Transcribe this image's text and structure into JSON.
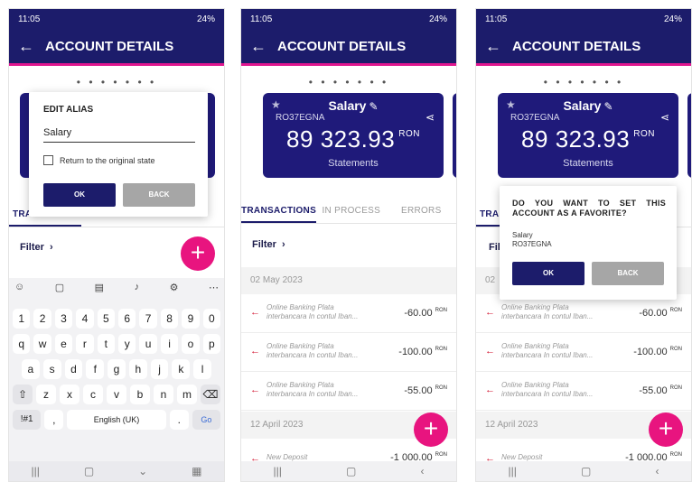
{
  "status": {
    "time": "11:05",
    "battery": "24%"
  },
  "header": {
    "back_icon": "←",
    "title": "ACCOUNT DETAILS"
  },
  "carousel": {
    "dots": "• • • • • • •"
  },
  "card": {
    "name": "Salary",
    "iban": "RO37EGNA",
    "amount": "89 323.93",
    "currency": "RON",
    "statements": "Statements"
  },
  "tabs": {
    "transactions": "TRANSACTIONS",
    "in_process": "IN PROCESS",
    "errors": "ERRORS",
    "transactions_cut": "TRA"
  },
  "filter": {
    "label": "Filter",
    "chevron": "›",
    "label_cut": "Fil"
  },
  "groups": [
    {
      "date": "02 May 2023"
    },
    {
      "date": "12 April 2023"
    }
  ],
  "transactions": [
    {
      "desc1": "Online Banking Plata",
      "desc2": "interbancara In contul Iban...",
      "amount": "-60.00",
      "cur": "RON"
    },
    {
      "desc1": "Online Banking Plata",
      "desc2": "interbancara In contul Iban...",
      "amount": "-100.00",
      "cur": "RON"
    },
    {
      "desc1": "Online Banking Plata",
      "desc2": "interbancara In contul Iban...",
      "amount": "-55.00",
      "cur": "RON"
    },
    {
      "desc1": "New Deposit",
      "desc2": "",
      "amount": "-1 000.00",
      "cur": "RON"
    }
  ],
  "edit_alias": {
    "title": "EDIT ALIAS",
    "value": "Salary",
    "checkbox_label": "Return to the original state",
    "ok": "OK",
    "back": "BACK"
  },
  "favorite": {
    "question": "DO YOU WANT TO SET THIS ACCOUNT AS A FAVORITE?",
    "name": "Salary",
    "iban": "RO37EGNA",
    "ok": "OK",
    "back": "BACK"
  },
  "keyboard": {
    "row1": [
      "1",
      "2",
      "3",
      "4",
      "5",
      "6",
      "7",
      "8",
      "9",
      "0"
    ],
    "row2": [
      "q",
      "w",
      "e",
      "r",
      "t",
      "y",
      "u",
      "i",
      "o",
      "p"
    ],
    "row3": [
      "a",
      "s",
      "d",
      "f",
      "g",
      "h",
      "j",
      "k",
      "l"
    ],
    "row4": [
      "z",
      "x",
      "c",
      "v",
      "b",
      "n",
      "m"
    ],
    "symbols": "!#1",
    "comma": ",",
    "space": "English (UK)",
    "period": ".",
    "go": "Go"
  },
  "colors": {
    "brand": "#1c1c6b",
    "accent": "#e8147f",
    "debit": "#d2122e"
  }
}
